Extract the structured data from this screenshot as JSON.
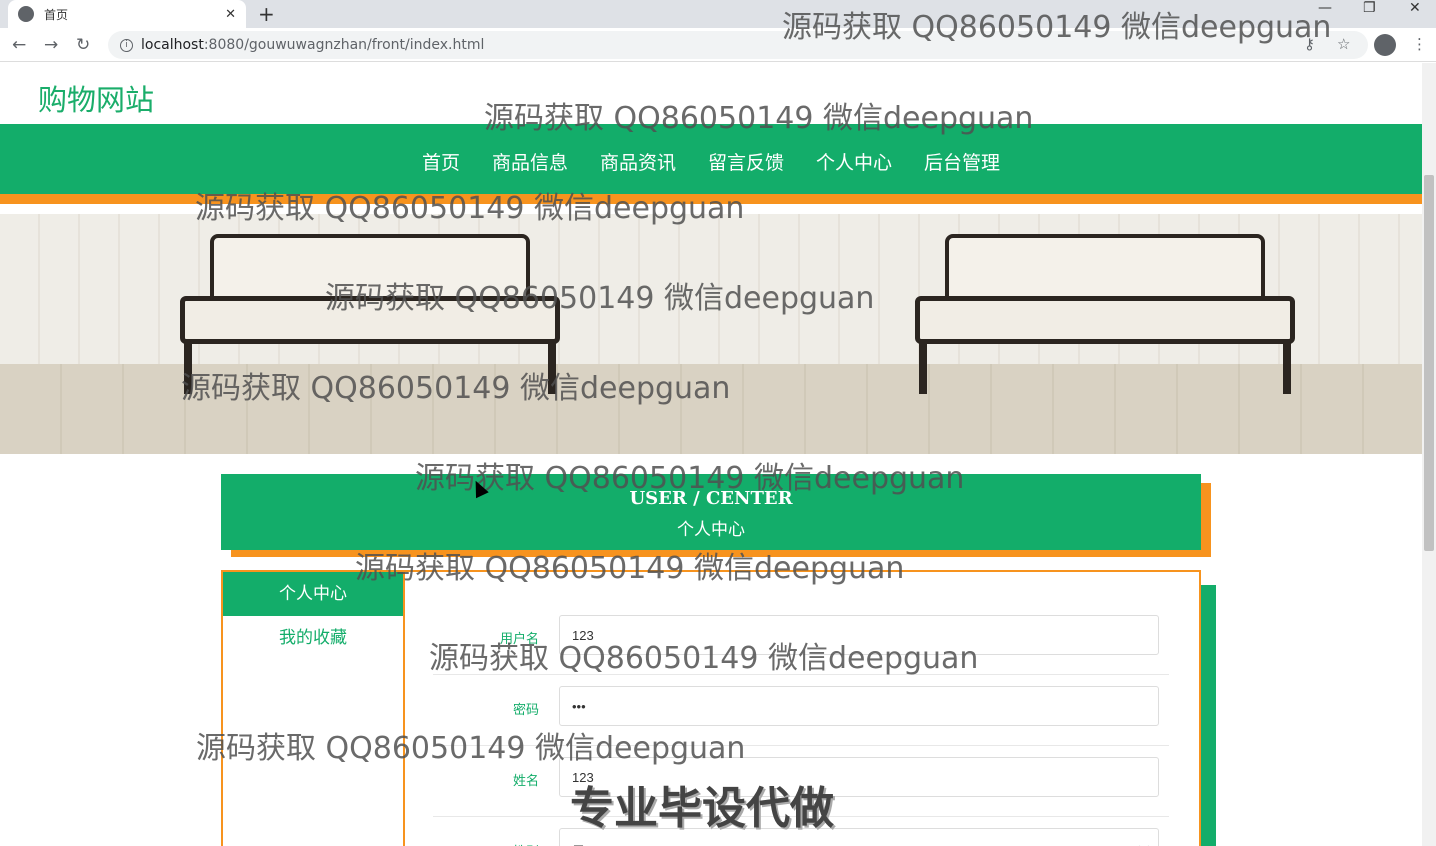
{
  "browser": {
    "tab_title": "首页",
    "tab_close": "✕",
    "new_tab": "+",
    "url_host": "localhost",
    "url_path": ":8080/gouwuwagnzhan/front/index.html",
    "minimize": "—",
    "restore": "❐",
    "close": "✕",
    "back": "←",
    "forward": "→",
    "reload": "↻",
    "key": "⚷",
    "star": "☆",
    "more": "⋮"
  },
  "site": {
    "title": "购物网站"
  },
  "nav": {
    "items": [
      "首页",
      "商品信息",
      "商品资讯",
      "留言反馈",
      "个人中心",
      "后台管理"
    ]
  },
  "carousel": {
    "slides": 3,
    "active": 1
  },
  "user_center": {
    "title_en": "USER / CENTER",
    "title_cn": "个人中心"
  },
  "sidebar": {
    "items": [
      "个人中心",
      "我的收藏"
    ]
  },
  "form": {
    "rows": [
      {
        "label": "用户名",
        "value": "123"
      },
      {
        "label": "密码",
        "value": "•••"
      },
      {
        "label": "姓名",
        "value": "123"
      },
      {
        "label": "性别",
        "value": "男"
      }
    ]
  },
  "watermark": {
    "text": "源码获取 QQ86050149 微信deepguan",
    "big_text": "专业毕设代做"
  },
  "colors": {
    "green": "#13ad6a",
    "orange": "#f7931e"
  }
}
